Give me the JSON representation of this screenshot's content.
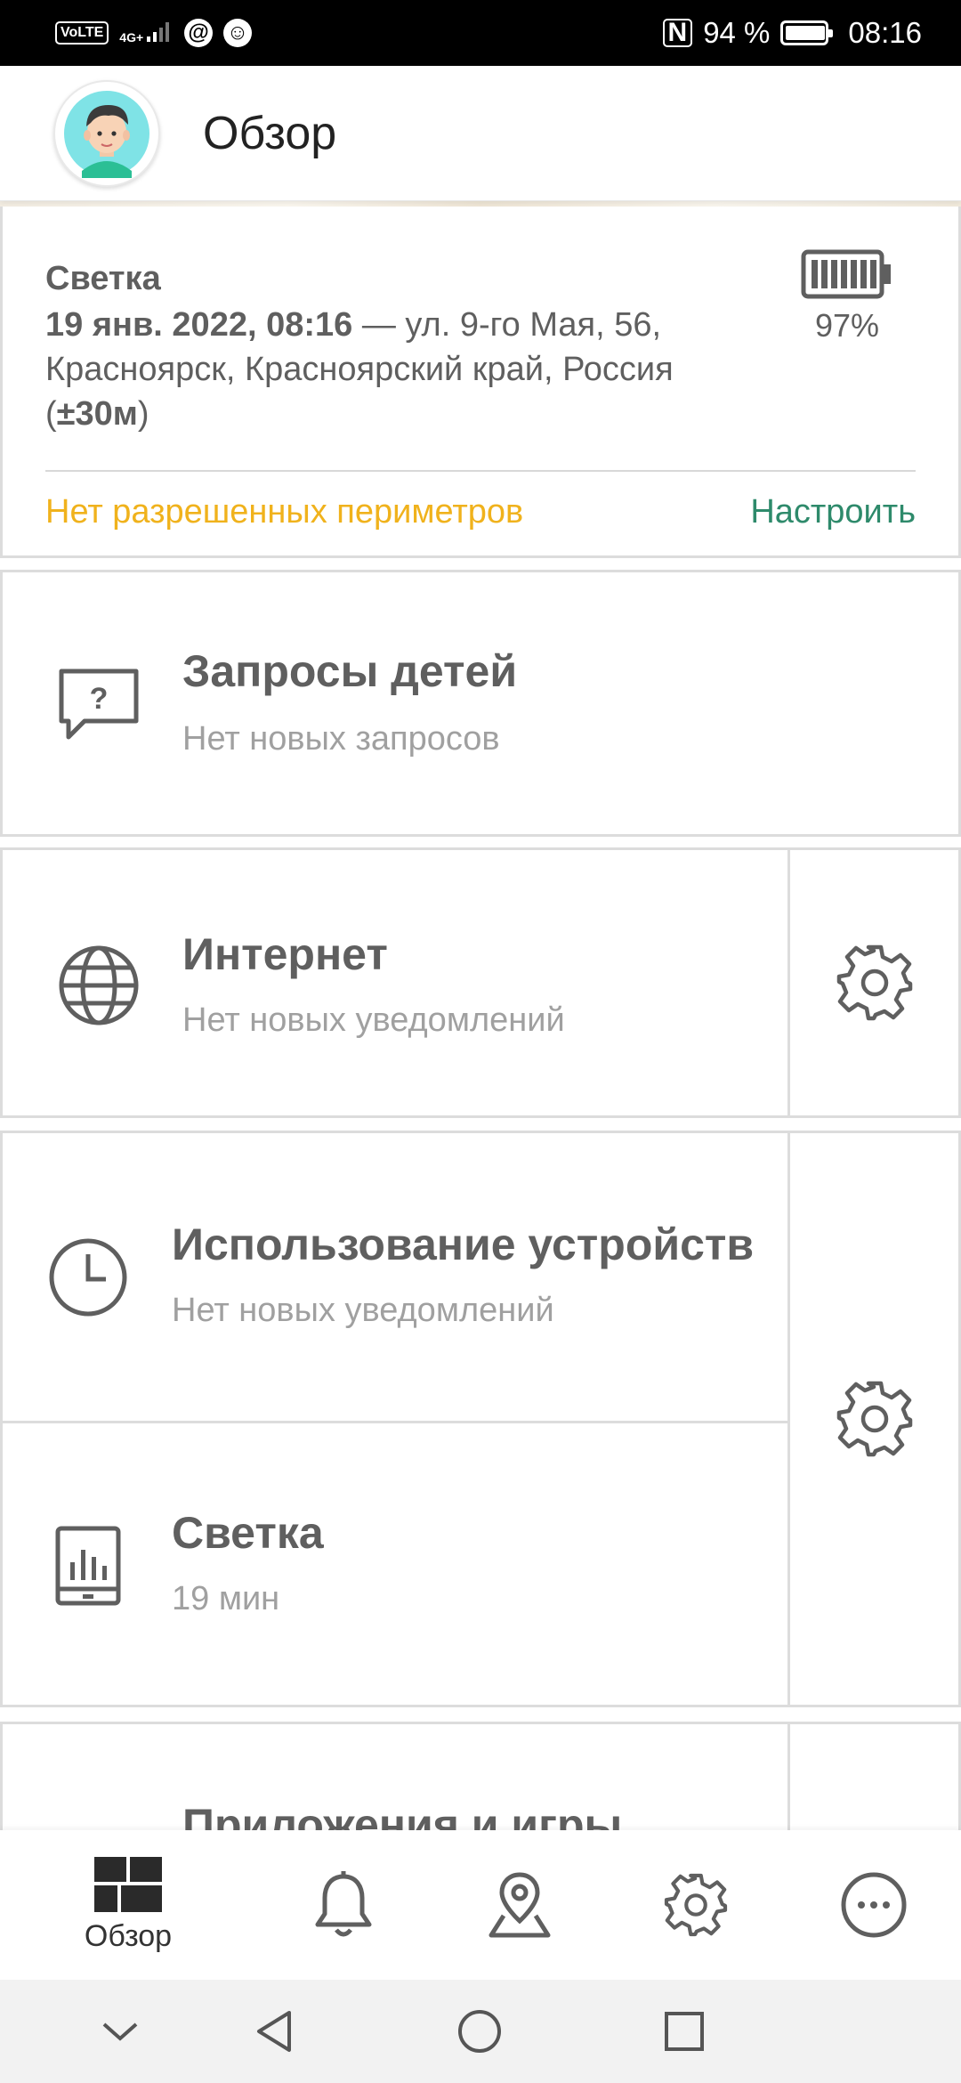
{
  "status_bar": {
    "volte": "VoLTE",
    "network": "4G+",
    "battery_percent": "94 %",
    "time": "08:16"
  },
  "header": {
    "title": "Обзор"
  },
  "location_card": {
    "child_name": "Светка",
    "timestamp": "19 янв. 2022, 08:16",
    "address_part1": " — ул. 9-го Мая, 56, Красноярск, Красноярский край, Россия (",
    "accuracy": "±30м",
    "address_part2": ")",
    "battery_level": "97%",
    "perimeter_status": "Нет разрешенных периметров",
    "configure_label": "Настроить"
  },
  "cards": {
    "requests": {
      "title": "Запросы детей",
      "subtitle": "Нет новых запросов"
    },
    "internet": {
      "title": "Интернет",
      "subtitle": "Нет новых уведомлений"
    },
    "device_usage": {
      "title": "Использование устройств",
      "subtitle": "Нет новых уведомлений"
    },
    "child_usage": {
      "title": "Светка",
      "subtitle": "19 мин"
    },
    "apps": {
      "title": "Приложения и игры"
    }
  },
  "bottom_nav": {
    "overview_label": "Обзор"
  },
  "colors": {
    "warning": "#f0b21c",
    "accent": "#2e8a6b",
    "text": "#5f5f5f",
    "muted": "#a0a0a0"
  }
}
